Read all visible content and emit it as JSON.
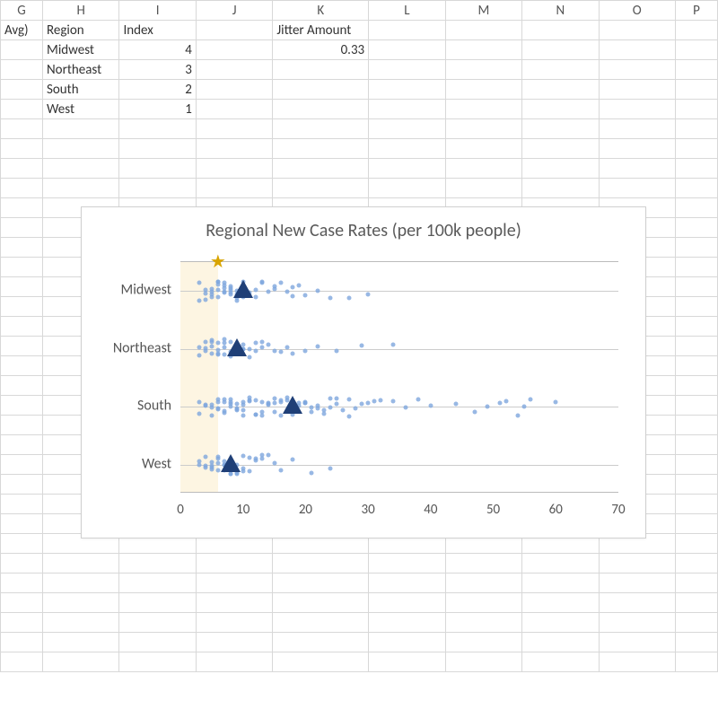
{
  "columns": [
    "G",
    "H",
    "I",
    "J",
    "K",
    "L",
    "M",
    "N",
    "O",
    "P"
  ],
  "cells": {
    "G1": "Avg)",
    "H1": "Region",
    "I1": "Index",
    "K1": "Jitter Amount",
    "H2": "Midwest",
    "I2": "4",
    "H3": "Northeast",
    "I3": "3",
    "H4": "South",
    "I4": "2",
    "H5": "West",
    "I5": "1",
    "K2": "0.33"
  },
  "chart_data": {
    "type": "scatter",
    "title": "Regional New Case Rates (per 100k people)",
    "xlabel": "",
    "ylabel": "",
    "xlim": [
      0,
      70
    ],
    "xticks": [
      0,
      10,
      20,
      30,
      40,
      50,
      60,
      70
    ],
    "categories": [
      "Midwest",
      "Northeast",
      "South",
      "West"
    ],
    "jitter": 0.33,
    "highlight_band": {
      "x0": 0,
      "x1": 6
    },
    "star_marker": {
      "x": 6,
      "y": 4.5
    },
    "series": [
      {
        "name": "Midwest",
        "mean": 10,
        "values": [
          3,
          3,
          4,
          4,
          4,
          5,
          5,
          5,
          5,
          6,
          6,
          6,
          6,
          6,
          7,
          7,
          7,
          7,
          7,
          8,
          8,
          8,
          8,
          8,
          9,
          9,
          9,
          9,
          10,
          10,
          10,
          10,
          11,
          11,
          12,
          12,
          13,
          13,
          14,
          15,
          15,
          16,
          17,
          18,
          18,
          19,
          20,
          22,
          24,
          27,
          30
        ]
      },
      {
        "name": "Northeast",
        "mean": 9,
        "values": [
          3,
          3,
          4,
          4,
          4,
          5,
          5,
          5,
          5,
          6,
          6,
          6,
          6,
          7,
          7,
          7,
          7,
          8,
          8,
          8,
          9,
          9,
          9,
          10,
          10,
          10,
          11,
          11,
          12,
          12,
          13,
          13,
          14,
          15,
          16,
          17,
          18,
          20,
          22,
          25,
          29,
          34
        ]
      },
      {
        "name": "South",
        "mean": 18,
        "values": [
          3,
          3,
          4,
          4,
          5,
          5,
          5,
          6,
          6,
          6,
          6,
          7,
          7,
          7,
          7,
          8,
          8,
          8,
          8,
          9,
          9,
          9,
          9,
          10,
          10,
          10,
          10,
          11,
          11,
          11,
          12,
          12,
          12,
          13,
          13,
          13,
          14,
          14,
          14,
          15,
          15,
          15,
          16,
          16,
          16,
          17,
          17,
          18,
          18,
          18,
          19,
          19,
          20,
          20,
          20,
          21,
          21,
          22,
          22,
          23,
          23,
          24,
          24,
          25,
          25,
          26,
          27,
          27,
          28,
          29,
          30,
          31,
          32,
          34,
          36,
          38,
          40,
          44,
          47,
          49,
          51,
          52,
          54,
          55,
          56,
          60
        ]
      },
      {
        "name": "West",
        "mean": 8,
        "values": [
          3,
          3,
          4,
          4,
          4,
          5,
          5,
          5,
          5,
          6,
          6,
          6,
          6,
          7,
          7,
          7,
          7,
          8,
          8,
          8,
          8,
          9,
          9,
          9,
          10,
          10,
          10,
          11,
          11,
          12,
          12,
          13,
          13,
          14,
          15,
          16,
          18,
          21,
          24
        ]
      }
    ]
  }
}
